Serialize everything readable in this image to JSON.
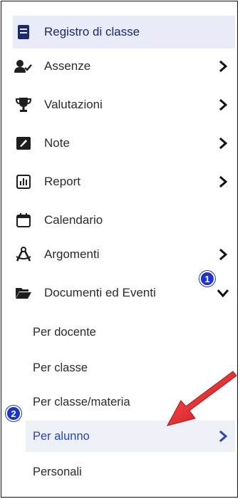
{
  "menu": {
    "header": {
      "label": "Registro di classe",
      "icon": "book-icon"
    },
    "items": [
      {
        "label": "Assenze",
        "icon": "user-check-icon",
        "expandable": true
      },
      {
        "label": "Valutazioni",
        "icon": "trophy-icon",
        "expandable": true
      },
      {
        "label": "Note",
        "icon": "note-icon",
        "expandable": true
      },
      {
        "label": "Report",
        "icon": "bar-chart-icon",
        "expandable": true
      },
      {
        "label": "Calendario",
        "icon": "calendar-icon",
        "expandable": false
      },
      {
        "label": "Argomenti",
        "icon": "compass-icon",
        "expandable": true
      },
      {
        "label": "Documenti ed Eventi",
        "icon": "folder-open-icon",
        "expanded": true
      }
    ],
    "subitems": [
      {
        "label": "Per docente"
      },
      {
        "label": "Per classe"
      },
      {
        "label": "Per classe/materia"
      },
      {
        "label": "Per alunno",
        "selected": true
      },
      {
        "label": "Personali"
      }
    ]
  },
  "annotations": {
    "badge_1": "1",
    "badge_2": "2"
  },
  "colors": {
    "accent": "#2a45b8",
    "active_bg": "#e9ebf8",
    "badge": "#1d33c9",
    "arrow": "#e3171d"
  }
}
